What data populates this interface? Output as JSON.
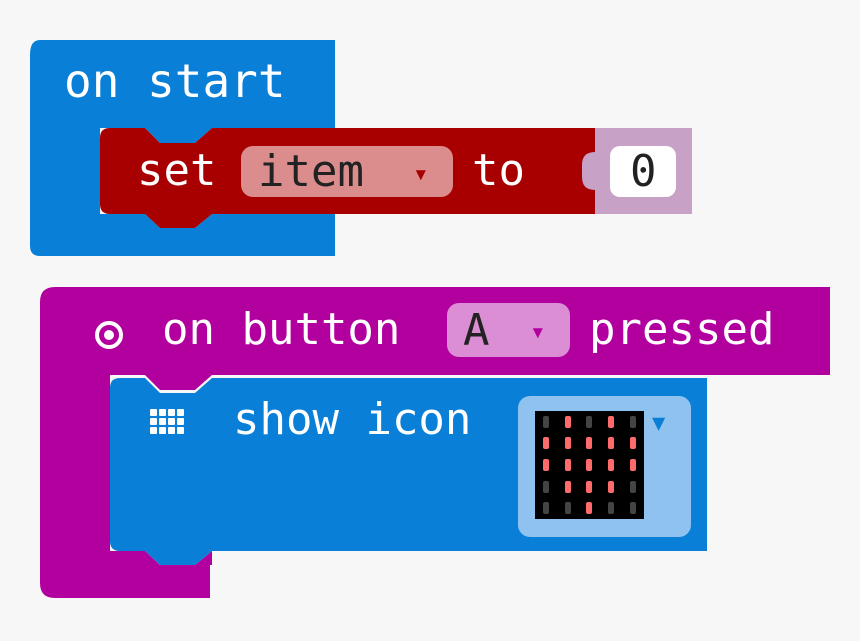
{
  "colors": {
    "background": "#f7f7f7",
    "basic": "#0a7fd8",
    "variables": "#a80000",
    "math": "#c7a1c6",
    "input": "#b2009f",
    "dropdown_light": "#db8d8d",
    "dropdown_input": "#dc8ed5",
    "led_on": "#ff6b6b",
    "led_off": "#444444"
  },
  "on_start_block": {
    "label": "on start"
  },
  "set_block": {
    "set_label": "set",
    "variable_name": "item",
    "dropdown_arrow": "▾",
    "to_label": "to",
    "value": "0"
  },
  "button_block": {
    "icon": "target-icon",
    "on_label": "on button",
    "button_value": "A",
    "dropdown_arrow": "▾",
    "pressed_label": "pressed"
  },
  "show_icon_block": {
    "icon": "grid-icon",
    "label": "show icon",
    "dropdown_arrow": "▼",
    "led_matrix": [
      [
        0,
        1,
        0,
        1,
        0
      ],
      [
        1,
        1,
        1,
        1,
        1
      ],
      [
        1,
        1,
        1,
        1,
        1
      ],
      [
        0,
        1,
        1,
        1,
        0
      ],
      [
        0,
        0,
        1,
        0,
        0
      ]
    ]
  }
}
